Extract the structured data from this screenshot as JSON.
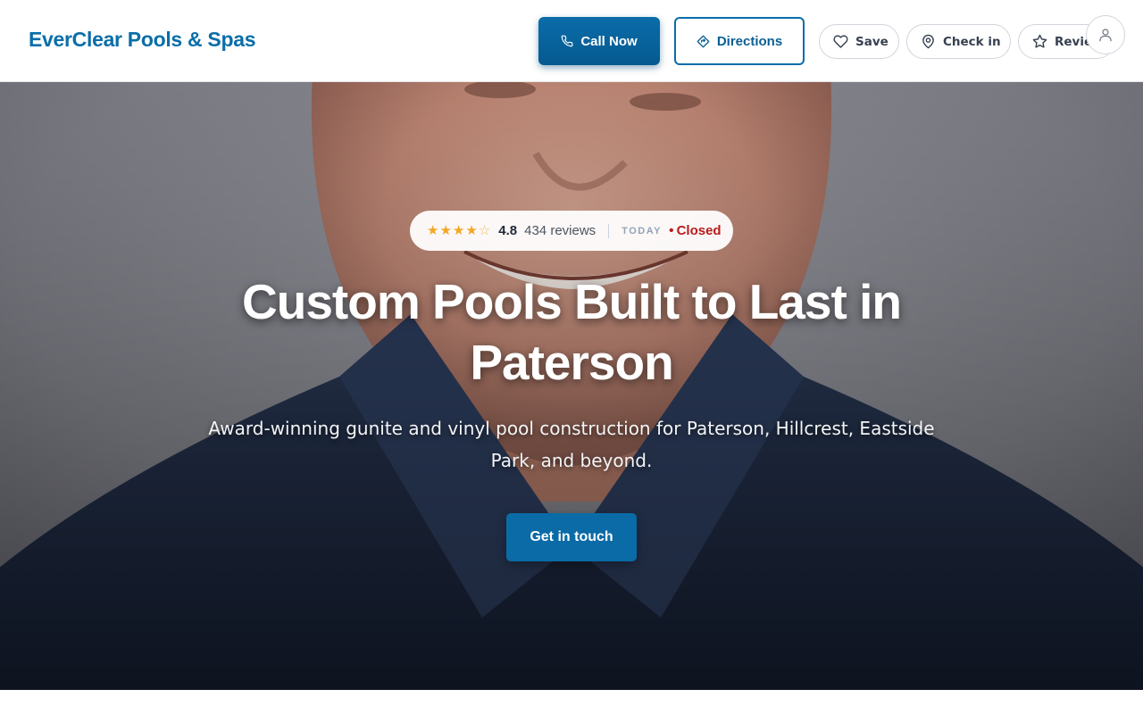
{
  "header": {
    "brand": "EverClear Pools & Spas",
    "call_label": "Call Now",
    "directions_label": "Directions",
    "save_label": "Save",
    "checkin_label": "Check in",
    "review_label": "Review"
  },
  "hero": {
    "rating": {
      "stars_value": 4.5,
      "value": "4.8",
      "count": "434 reviews",
      "today_label": "TODAY",
      "status_dot": "•",
      "status": "Closed"
    },
    "headline": "Custom Pools Built to Last in Paterson",
    "subheadline": "Award-winning gunite and vinyl pool construction for Paterson, Hillcrest, Eastside Park, and beyond.",
    "cta_label": "Get in touch"
  },
  "icons": {
    "call": "phone-icon",
    "directions": "directions-icon",
    "save": "heart-icon",
    "checkin": "map-pin-icon",
    "review": "star-icon",
    "account": "user-icon"
  },
  "colors": {
    "brand": "#0a6ea8",
    "primary_button": "#0a6ba6",
    "star": "#f5a623",
    "status_closed": "#b91c1c"
  }
}
